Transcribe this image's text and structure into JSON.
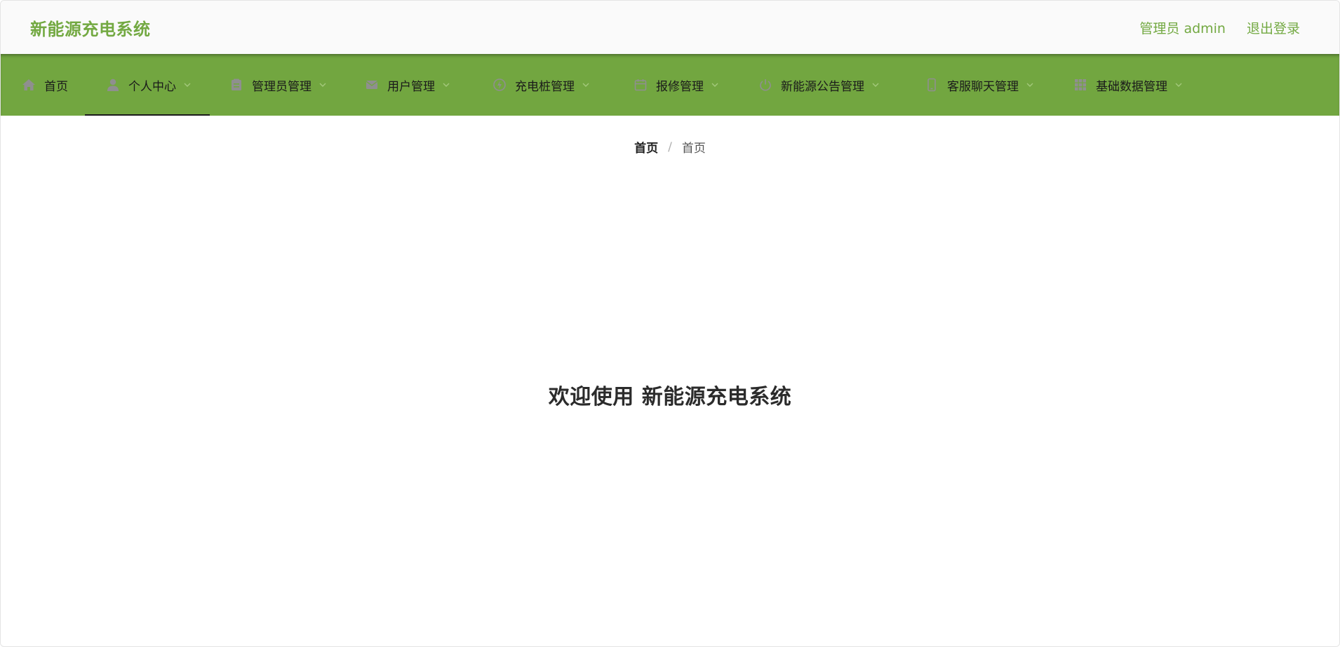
{
  "header": {
    "app_title": "新能源充电系统",
    "user_label": "管理员 admin",
    "logout_label": "退出登录"
  },
  "nav": {
    "items": [
      {
        "label": "首页",
        "icon": "home-icon",
        "has_dropdown": false,
        "active": false
      },
      {
        "label": "个人中心",
        "icon": "user-icon",
        "has_dropdown": true,
        "active": true
      },
      {
        "label": "管理员管理",
        "icon": "admin-card-icon",
        "has_dropdown": true,
        "active": false
      },
      {
        "label": "用户管理",
        "icon": "users-icon",
        "has_dropdown": true,
        "active": false
      },
      {
        "label": "充电桩管理",
        "icon": "charger-icon",
        "has_dropdown": true,
        "active": false
      },
      {
        "label": "报修管理",
        "icon": "calendar-icon",
        "has_dropdown": true,
        "active": false
      },
      {
        "label": "新能源公告管理",
        "icon": "power-icon",
        "has_dropdown": true,
        "active": false
      },
      {
        "label": "客服聊天管理",
        "icon": "phone-icon",
        "has_dropdown": true,
        "active": false
      },
      {
        "label": "基础数据管理",
        "icon": "grid-icon",
        "has_dropdown": true,
        "active": false
      }
    ]
  },
  "breadcrumb": {
    "items": [
      "首页",
      "首页"
    ],
    "separator": "/"
  },
  "main": {
    "welcome_text": "欢迎使用 新能源充电系统"
  },
  "colors": {
    "brand_green": "#73a942",
    "nav_background": "#72a640",
    "icon_gray": "#8f8f8f"
  }
}
